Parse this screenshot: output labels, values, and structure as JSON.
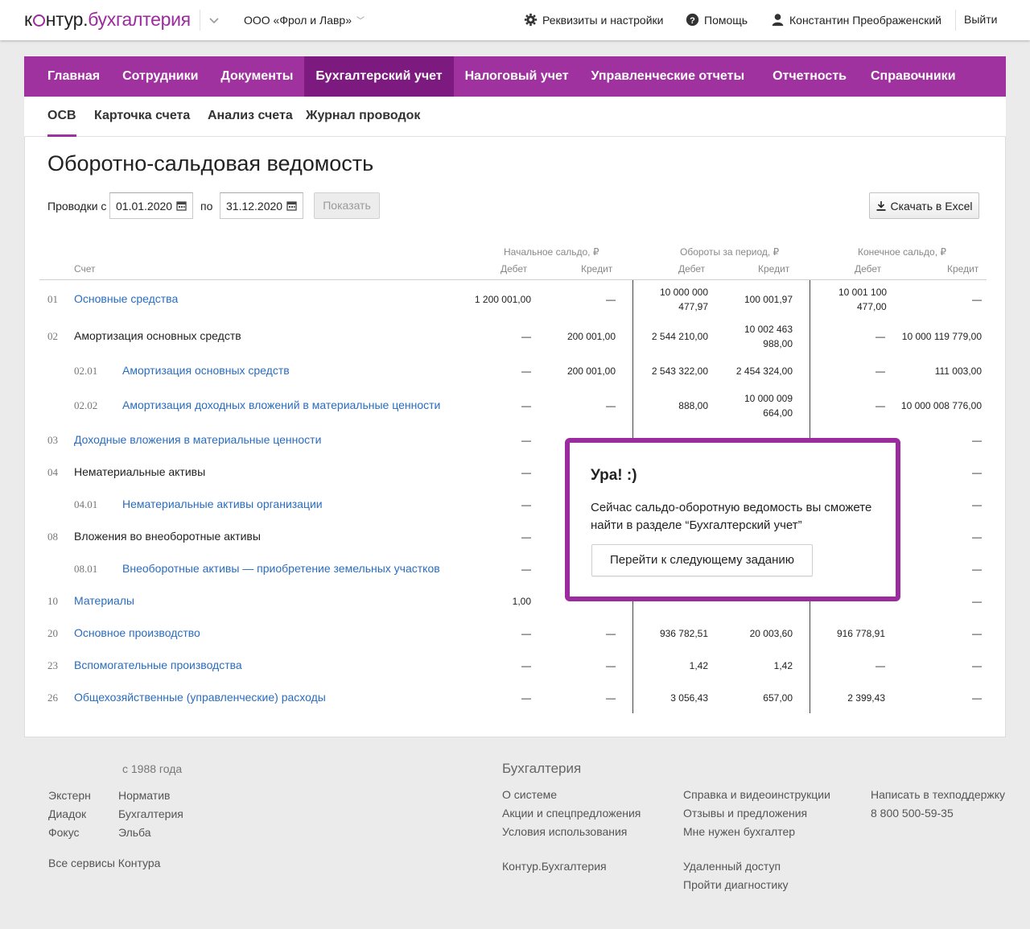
{
  "header": {
    "logo_left": "к",
    "logo_mid": "нтур.",
    "logo_product": "бухгалтерия",
    "organization": "ООО «Фрол и Лавр»",
    "settings_label": "Реквизиты и настройки",
    "help_label": "Помощь",
    "user_label": "Константин Преображенский",
    "logout_label": "Выйти"
  },
  "main_nav": {
    "items": [
      "Главная",
      "Сотрудники",
      "Документы",
      "Бухгалтерский учет",
      "Налоговый учет",
      "Управленческие отчеты",
      "Отчетность",
      "Справочники"
    ],
    "active": "Бухгалтерский учет"
  },
  "sub_nav": {
    "items": [
      "ОСВ",
      "Карточка счета",
      "Анализ счета",
      "Журнал проводок"
    ],
    "active": "ОСВ"
  },
  "page": {
    "title": "Оборотно-сальдовая ведомость",
    "filter_label": "Проводки с",
    "filter_to": "по",
    "date_from": "01.01.2020",
    "date_to": "31.12.2020",
    "show_button": "Показать",
    "excel_button": "Скачать в Excel"
  },
  "table": {
    "group_headers": [
      "Начальное сальдо, ₽",
      "Обороты за период, ₽",
      "Конечное сальдо, ₽"
    ],
    "col_account": "Счет",
    "col_debit": "Дебет",
    "col_credit": "Кредит",
    "rows": [
      {
        "code": "01",
        "name": "Основные средства",
        "sd": "1 200 001,00",
        "sc": "—",
        "td1": "10 000 000",
        "td2": "477,97",
        "tc": "100 001,97",
        "ed1": "10 001 100",
        "ed2": "477,00",
        "ec": "—"
      },
      {
        "code": "02",
        "name": "Амортизация основных средств",
        "sd": "—",
        "sc": "200 001,00",
        "td": "2 544 210,00",
        "tc1": "10 002 463",
        "tc2": "988,00",
        "ed": "—",
        "ec": "10 000 119 779,00"
      },
      {
        "code": "02.01",
        "name": "Амортизация основных средств",
        "sd": "—",
        "sc": "200 001,00",
        "td": "2 543 322,00",
        "tc": "2 454 324,00",
        "ed": "—",
        "ec": "111 003,00"
      },
      {
        "code": "02.02",
        "name": "Амортизация доходных вложений в материальные ценности",
        "sd": "—",
        "sc": "—",
        "td": "888,00",
        "tc1": "10 000 009",
        "tc2": "664,00",
        "ed": "—",
        "ec": "10 000 008 776,00"
      },
      {
        "code": "03",
        "name": "Доходные вложения в материальные ценности",
        "sd": "—",
        "ec": "—"
      },
      {
        "code": "04",
        "name": "Нематериальные активы",
        "sd": "—",
        "ec": "—"
      },
      {
        "code": "04.01",
        "name": "Нематериальные активы организации",
        "sd": "—",
        "ec": "—"
      },
      {
        "code": "08",
        "name": "Вложения во внеоборотные активы",
        "sd": "—",
        "ec": "—"
      },
      {
        "code": "08.01",
        "name": "Внеоборотные активы — приобретение земельных участков",
        "sd": "—",
        "ec": "—"
      },
      {
        "code": "10",
        "name": "Материалы",
        "sd": "1,00",
        "ec": "—"
      },
      {
        "code": "20",
        "name": "Основное производство",
        "sd": "—",
        "sc": "—",
        "td": "936 782,51",
        "tc": "20 003,60",
        "ed": "916 778,91",
        "ec": "—"
      },
      {
        "code": "23",
        "name": "Вспомогательные производства",
        "sd": "—",
        "sc": "—",
        "td": "1,42",
        "tc": "1,42",
        "ed": "—",
        "ec": "—"
      },
      {
        "code": "26",
        "name": "Общехозяйственные (управленческие) расходы",
        "sd": "—",
        "sc": "—",
        "td": "3 056,43",
        "tc": "657,00",
        "ed": "2 399,43",
        "ec": "—"
      }
    ]
  },
  "popup": {
    "title": "Ура! :)",
    "text": "Сейчас сальдо-оборотную ведомость вы сможете найти в разделе “Бухгалтерский учет”",
    "button": "Перейти к следующему заданию"
  },
  "footer": {
    "since": "с 1988 года",
    "services_col1": [
      "Экстерн",
      "Диадок",
      "Фокус"
    ],
    "services_col2": [
      "Норматив",
      "Бухгалтерия",
      "Эльба"
    ],
    "all_services": "Все сервисы Контура",
    "section_title": "Бухгалтерия",
    "links_col1": [
      "О системе",
      "Акции и спецпредложения",
      "Условия использования"
    ],
    "product_link": "Контур.Бухгалтерия",
    "links_col2": [
      "Справка и видеоинструкции",
      "Отзывы и предложения",
      "Мне нужен бухгалтер"
    ],
    "links_col2b": [
      "Удаленный доступ",
      "Пройти диагностику"
    ],
    "support_label": "Написать в техподдержку",
    "phone": "8 800 500-59-35"
  },
  "colors": {
    "brand": "#a0329f",
    "brand_active": "#7c1a7f",
    "link": "#2a6cbf",
    "popup_border": "#9b2b9e"
  }
}
